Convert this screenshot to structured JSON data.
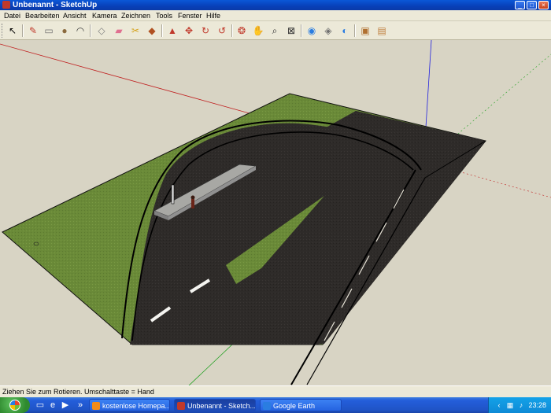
{
  "window": {
    "title": "Unbenannt - SketchUp",
    "controls": {
      "minimize": "_",
      "maximize": "□",
      "close": "×"
    }
  },
  "menu": [
    "Datei",
    "Bearbeiten",
    "Ansicht",
    "Kamera",
    "Zeichnen",
    "Tools",
    "Fenster",
    "Hilfe"
  ],
  "toolbar": {
    "tools": [
      {
        "name": "select-tool",
        "glyph": "↖",
        "color": "#000000"
      },
      {
        "name": "pencil-tool",
        "glyph": "✎",
        "color": "#c0392b"
      },
      {
        "name": "rectangle-tool",
        "glyph": "▭",
        "color": "#707070"
      },
      {
        "name": "circle-tool",
        "glyph": "●",
        "color": "#8b6a3e"
      },
      {
        "name": "arc-tool",
        "glyph": "◠",
        "color": "#404040"
      },
      {
        "name": "make-component-tool",
        "glyph": "◇",
        "color": "#808080"
      },
      {
        "name": "eraser-tool",
        "glyph": "▰",
        "color": "#e07090"
      },
      {
        "name": "tape-measure-tool",
        "glyph": "✂",
        "color": "#d4a017"
      },
      {
        "name": "paint-bucket-tool",
        "glyph": "◆",
        "color": "#b05020"
      },
      {
        "name": "push-pull-tool",
        "glyph": "▲",
        "color": "#c0392b"
      },
      {
        "name": "move-tool",
        "glyph": "✥",
        "color": "#c0392b"
      },
      {
        "name": "rotate-tool",
        "glyph": "↻",
        "color": "#c0392b"
      },
      {
        "name": "offset-tool",
        "glyph": "↺",
        "color": "#c0392b"
      },
      {
        "name": "orbit-tool",
        "glyph": "❂",
        "color": "#c0392b"
      },
      {
        "name": "pan-tool",
        "glyph": "✋",
        "color": "#505050"
      },
      {
        "name": "zoom-tool",
        "glyph": "⌕",
        "color": "#303030"
      },
      {
        "name": "zoom-extents-tool",
        "glyph": "⊠",
        "color": "#303030"
      },
      {
        "name": "get-current-view-tool",
        "glyph": "◉",
        "color": "#2a7de1"
      },
      {
        "name": "toggle-terrain-tool",
        "glyph": "◈",
        "color": "#707070"
      },
      {
        "name": "place-model-tool",
        "glyph": "◐",
        "color": "#2a7de1"
      },
      {
        "name": "get-models-tool",
        "glyph": "▣",
        "color": "#b07030"
      },
      {
        "name": "share-model-tool",
        "glyph": "▤",
        "color": "#c08040"
      }
    ]
  },
  "status": {
    "hint": "Ziehen Sie zum Rotieren.  Umschalttaste = Hand"
  },
  "taskbar": {
    "tasks": [
      {
        "label": "kostenlose Homepa...",
        "icon_color": "#f28c1c"
      },
      {
        "label": "Unbenannt - Sketch...",
        "icon_color": "#c0392b"
      },
      {
        "label": "Google Earth",
        "icon_color": "#2a7de1"
      }
    ],
    "clock": "23:28"
  },
  "colors": {
    "sky_ground": "#d8d4c4",
    "grass": "#6a8a38",
    "asphalt": "#2e2b29",
    "curb": "#000000",
    "bench": "#a8a8a4",
    "red_axis": "#c02020",
    "green_axis": "#20a020",
    "blue_axis": "#2020e0"
  }
}
